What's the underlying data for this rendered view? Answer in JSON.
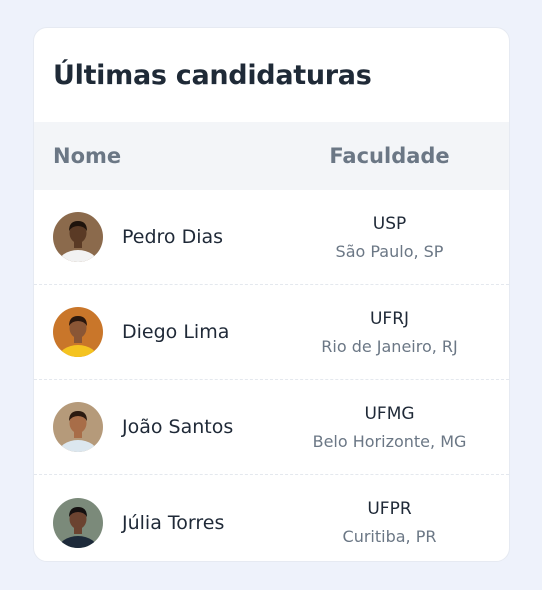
{
  "card": {
    "title": "Últimas candidaturas"
  },
  "table": {
    "headers": {
      "name": "Nome",
      "faculty": "Faculdade"
    },
    "rows": [
      {
        "name": "Pedro Dias",
        "faculty": "USP",
        "city": "São Paulo, SP",
        "avatar": {
          "icon": "user-photo",
          "bg": "#8b6a4c",
          "skin": "#5a3a25",
          "shirt": "#f2f2f2",
          "hair": "#1e130c"
        }
      },
      {
        "name": "Diego Lima",
        "faculty": "UFRJ",
        "city": "Rio de Janeiro, RJ",
        "avatar": {
          "icon": "user-photo",
          "bg": "#c9762a",
          "skin": "#8a5635",
          "shirt": "#f4c320",
          "hair": "#2a170d"
        }
      },
      {
        "name": "João Santos",
        "faculty": "UFMG",
        "city": "Belo Horizonte, MG",
        "avatar": {
          "icon": "user-photo",
          "bg": "#b59a7a",
          "skin": "#a86d48",
          "shirt": "#dce7ef",
          "hair": "#2b1a10"
        }
      },
      {
        "name": "Júlia Torres",
        "faculty": "UFPR",
        "city": "Curitiba, PR",
        "avatar": {
          "icon": "user-photo",
          "bg": "#7b8a7a",
          "skin": "#6b4330",
          "shirt": "#1d2a3a",
          "hair": "#141010"
        }
      }
    ]
  }
}
